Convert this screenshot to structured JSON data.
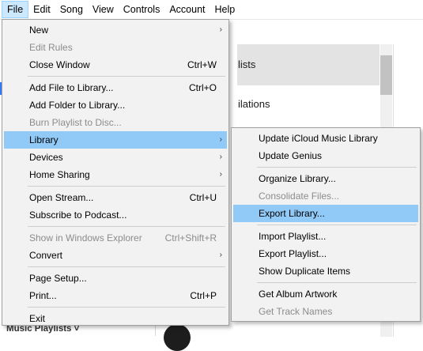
{
  "menubar": {
    "items": [
      "File",
      "Edit",
      "Song",
      "View",
      "Controls",
      "Account",
      "Help"
    ]
  },
  "background": {
    "item1": "lists",
    "item2": "ilations",
    "music_playlists": "Music Playlists ˅"
  },
  "file_menu": {
    "items": [
      {
        "label": "New",
        "shortcut": "",
        "arrow": "›",
        "disabled": false
      },
      {
        "label": "Edit Rules",
        "shortcut": "",
        "arrow": "",
        "disabled": true
      },
      {
        "label": "Close Window",
        "shortcut": "Ctrl+W",
        "arrow": "",
        "disabled": false
      },
      {
        "label": "Add File to Library...",
        "shortcut": "Ctrl+O",
        "arrow": "",
        "disabled": false
      },
      {
        "label": "Add Folder to Library...",
        "shortcut": "",
        "arrow": "",
        "disabled": false
      },
      {
        "label": "Burn Playlist to Disc...",
        "shortcut": "",
        "arrow": "",
        "disabled": true
      },
      {
        "label": "Library",
        "shortcut": "",
        "arrow": "›",
        "disabled": false
      },
      {
        "label": "Devices",
        "shortcut": "",
        "arrow": "›",
        "disabled": false
      },
      {
        "label": "Home Sharing",
        "shortcut": "",
        "arrow": "›",
        "disabled": false
      },
      {
        "label": "Open Stream...",
        "shortcut": "Ctrl+U",
        "arrow": "",
        "disabled": false
      },
      {
        "label": "Subscribe to Podcast...",
        "shortcut": "",
        "arrow": "",
        "disabled": false
      },
      {
        "label": "Show in Windows Explorer",
        "shortcut": "Ctrl+Shift+R",
        "arrow": "",
        "disabled": true
      },
      {
        "label": "Convert",
        "shortcut": "",
        "arrow": "›",
        "disabled": false
      },
      {
        "label": "Page Setup...",
        "shortcut": "",
        "arrow": "",
        "disabled": false
      },
      {
        "label": "Print...",
        "shortcut": "Ctrl+P",
        "arrow": "",
        "disabled": false
      },
      {
        "label": "Exit",
        "shortcut": "",
        "arrow": "",
        "disabled": false
      }
    ]
  },
  "library_menu": {
    "items": [
      {
        "label": "Update iCloud Music Library",
        "disabled": false
      },
      {
        "label": "Update Genius",
        "disabled": false
      },
      {
        "label": "Organize Library...",
        "disabled": false
      },
      {
        "label": "Consolidate Files...",
        "disabled": true
      },
      {
        "label": "Export Library...",
        "disabled": false
      },
      {
        "label": "Import Playlist...",
        "disabled": false
      },
      {
        "label": "Export Playlist...",
        "disabled": false
      },
      {
        "label": "Show Duplicate Items",
        "disabled": false
      },
      {
        "label": "Get Album Artwork",
        "disabled": false
      },
      {
        "label": "Get Track Names",
        "disabled": true
      }
    ]
  }
}
